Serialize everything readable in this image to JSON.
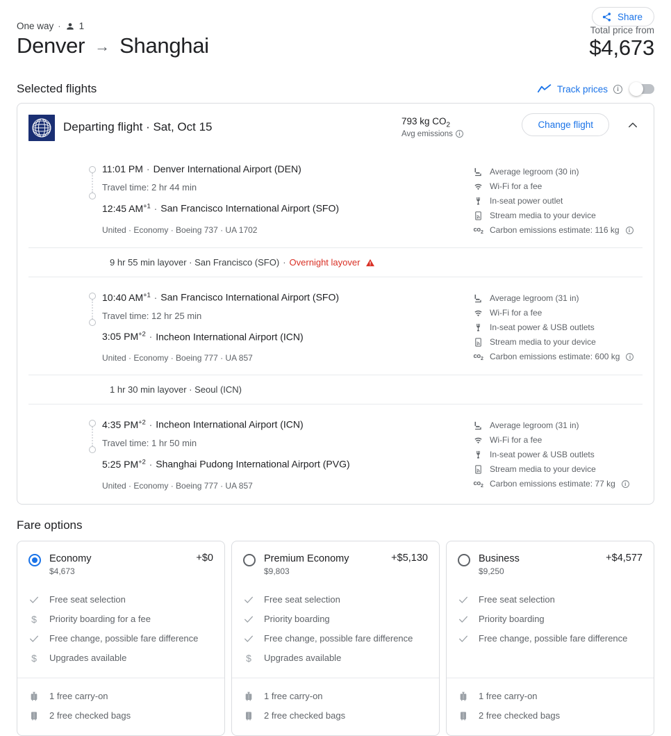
{
  "header": {
    "trip_type": "One way",
    "separator": "·",
    "passengers": "1",
    "origin_city": "Denver",
    "arrow": "→",
    "destination_city": "Shanghai",
    "share_label": "Share",
    "total_price_label": "Total price from",
    "total_price": "$4,673"
  },
  "selected_flights": {
    "title": "Selected flights",
    "track_prices_label": "Track prices",
    "track_prices_info": "i",
    "toggle_state": "off"
  },
  "flight_card": {
    "airline": "United",
    "heading": "Departing flight · Sat, Oct 15",
    "emissions_value": "793 kg CO",
    "emissions_sub": "2",
    "emissions_label": "Avg emissions",
    "change_flight_label": "Change flight",
    "collapse_icon": "chevron-up-icon",
    "legs": [
      {
        "depart_time": "11:01 PM",
        "depart_offset": "",
        "depart_airport": "Denver International Airport (DEN)",
        "travel_time": "Travel time: 2 hr 44 min",
        "arrive_time": "12:45 AM",
        "arrive_offset": "+1",
        "arrive_airport": "San Francisco International Airport (SFO)",
        "operator_line": "United · Economy · Boeing 737 · UA 1702",
        "amenities": [
          {
            "icon": "legroom-icon",
            "text": "Average legroom (30 in)"
          },
          {
            "icon": "wifi-icon",
            "text": "Wi-Fi for a fee"
          },
          {
            "icon": "power-outlet-icon",
            "text": "In-seat power outlet"
          },
          {
            "icon": "stream-media-icon",
            "text": "Stream media to your device"
          },
          {
            "icon": "co2-icon",
            "text": "Carbon emissions estimate: 116 kg",
            "info": true
          }
        ]
      },
      {
        "depart_time": "10:40 AM",
        "depart_offset": "+1",
        "depart_airport": "San Francisco International Airport (SFO)",
        "travel_time": "Travel time: 12 hr 25 min",
        "arrive_time": "3:05 PM",
        "arrive_offset": "+2",
        "arrive_airport": "Incheon International Airport (ICN)",
        "operator_line": "United · Economy · Boeing 777 · UA 857",
        "amenities": [
          {
            "icon": "legroom-icon",
            "text": "Average legroom (31 in)"
          },
          {
            "icon": "wifi-icon",
            "text": "Wi-Fi for a fee"
          },
          {
            "icon": "power-outlet-icon",
            "text": "In-seat power & USB outlets"
          },
          {
            "icon": "stream-media-icon",
            "text": "Stream media to your device"
          },
          {
            "icon": "co2-icon",
            "text": "Carbon emissions estimate: 600 kg",
            "info": true
          }
        ]
      },
      {
        "depart_time": "4:35 PM",
        "depart_offset": "+2",
        "depart_airport": "Incheon International Airport (ICN)",
        "travel_time": "Travel time: 1 hr 50 min",
        "arrive_time": "5:25 PM",
        "arrive_offset": "+2",
        "arrive_airport": "Shanghai Pudong International Airport (PVG)",
        "operator_line": "United · Economy · Boeing 777 · UA 857",
        "amenities": [
          {
            "icon": "legroom-icon",
            "text": "Average legroom (31 in)"
          },
          {
            "icon": "wifi-icon",
            "text": "Wi-Fi for a fee"
          },
          {
            "icon": "power-outlet-icon",
            "text": "In-seat power & USB outlets"
          },
          {
            "icon": "stream-media-icon",
            "text": "Stream media to your device"
          },
          {
            "icon": "co2-icon",
            "text": "Carbon emissions estimate: 77 kg",
            "info": true
          }
        ]
      }
    ],
    "layovers": [
      {
        "duration_place": "9 hr 55 min layover · San Francisco (SFO)",
        "sep": "·",
        "warning": "Overnight layover",
        "has_warning_icon": true
      },
      {
        "duration_place": "1 hr 30 min layover · Seoul (ICN)",
        "sep": "",
        "warning": "",
        "has_warning_icon": false
      }
    ]
  },
  "fare_options": {
    "title": "Fare options",
    "cards": [
      {
        "name": "Economy",
        "price": "$4,673",
        "delta": "+$0",
        "selected": true,
        "features": [
          {
            "icon": "check-icon",
            "text": "Free seat selection"
          },
          {
            "icon": "dollar-icon",
            "text": "Priority boarding for a fee"
          },
          {
            "icon": "check-icon",
            "text": "Free change, possible fare difference"
          },
          {
            "icon": "dollar-icon",
            "text": "Upgrades available"
          }
        ],
        "bags": [
          {
            "icon": "carry-on-icon",
            "text": "1 free carry-on"
          },
          {
            "icon": "checked-bag-icon",
            "text": "2 free checked bags"
          }
        ]
      },
      {
        "name": "Premium Economy",
        "price": "$9,803",
        "delta": "+$5,130",
        "selected": false,
        "features": [
          {
            "icon": "check-icon",
            "text": "Free seat selection"
          },
          {
            "icon": "check-icon",
            "text": "Priority boarding"
          },
          {
            "icon": "check-icon",
            "text": "Free change, possible fare difference"
          },
          {
            "icon": "dollar-icon",
            "text": "Upgrades available"
          }
        ],
        "bags": [
          {
            "icon": "carry-on-icon",
            "text": "1 free carry-on"
          },
          {
            "icon": "checked-bag-icon",
            "text": "2 free checked bags"
          }
        ]
      },
      {
        "name": "Business",
        "price": "$9,250",
        "delta": "+$4,577",
        "selected": false,
        "features": [
          {
            "icon": "check-icon",
            "text": "Free seat selection"
          },
          {
            "icon": "check-icon",
            "text": "Priority boarding"
          },
          {
            "icon": "check-icon",
            "text": "Free change, possible fare difference"
          }
        ],
        "bags": [
          {
            "icon": "carry-on-icon",
            "text": "1 free carry-on"
          },
          {
            "icon": "checked-bag-icon",
            "text": "2 free checked bags"
          }
        ]
      }
    ]
  },
  "colors": {
    "accent_blue": "#1a73e8",
    "warning_red": "#d93025",
    "united_navy": "#1a2f73",
    "text_primary": "#202124",
    "text_secondary": "#5f6368",
    "border": "#dadce0"
  }
}
